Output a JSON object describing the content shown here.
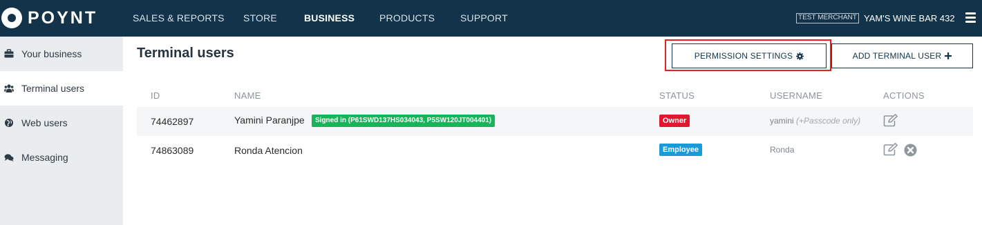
{
  "brand": {
    "name": "POYNT"
  },
  "nav": [
    {
      "label": "SALES & REPORTS",
      "active": false
    },
    {
      "label": "STORE",
      "active": false
    },
    {
      "label": "BUSINESS",
      "active": true
    },
    {
      "label": "PRODUCTS",
      "active": false
    },
    {
      "label": "SUPPORT",
      "active": false
    }
  ],
  "merchant": {
    "badge": "TEST MERCHANT",
    "name": "YAM'S WINE BAR 432",
    "menu_icon": "hamburger-icon"
  },
  "sidebar": {
    "items": [
      {
        "label": "Your business",
        "icon": "briefcase-icon",
        "active": false
      },
      {
        "label": "Terminal users",
        "icon": "users-icon",
        "active": true
      },
      {
        "label": "Web users",
        "icon": "globe-icon",
        "active": false
      },
      {
        "label": "Messaging",
        "icon": "chat-icon",
        "active": false
      }
    ]
  },
  "main": {
    "title": "Terminal users",
    "permission_button": {
      "label": "PERMISSION SETTINGS",
      "icon": "gear-icon"
    },
    "add_button": {
      "label": "ADD TERMINAL USER",
      "icon": "plus-icon"
    },
    "columns": [
      "ID",
      "NAME",
      "STATUS",
      "USERNAME",
      "ACTIONS"
    ],
    "rows": [
      {
        "id": "74462897",
        "name": "Yamini Paranjpe",
        "signed_in": "Signed in (P61SWD137HS034043, P5SW120JT004401)",
        "status": "Owner",
        "username": "yamini",
        "username_note": "(+Passcode only)",
        "actions": [
          "edit-icon"
        ]
      },
      {
        "id": "74863089",
        "name": "Ronda Atencion",
        "status": "Employee",
        "username": "Ronda",
        "actions": [
          "edit-icon",
          "delete-icon"
        ]
      }
    ]
  },
  "colors": {
    "topbar": "#13334a",
    "sidebar": "#eaedf0",
    "owner_badge": "#e4162e",
    "employee_badge": "#1a9ad6",
    "signed_in_badge": "#19b35a",
    "highlight": "#e6201f"
  }
}
